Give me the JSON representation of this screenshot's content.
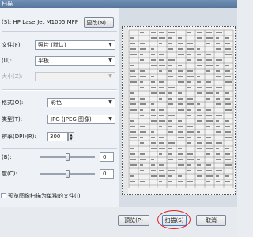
{
  "window": {
    "title": "扫描"
  },
  "scanner": {
    "label": "(S): HP LaserJet M1005 MFP",
    "change_button": "更改(N)..."
  },
  "settings": {
    "profile_label": "文件(F):",
    "profile_value": "照片 (默认)",
    "source_label": "(U):",
    "source_value": "平板",
    "paper_size_label": "大小(Z):",
    "paper_size_value": "",
    "color_format_label": "格式(O):",
    "color_format_value": "彩色",
    "file_type_label": "类型(T):",
    "file_type_value": "JPG (JPEG 图像)",
    "resolution_label": "辨率(DPI)(R):",
    "resolution_value": "300",
    "brightness_label": "(B):",
    "brightness_value": "0",
    "brightness_level": 0.5,
    "contrast_label": "度(C):",
    "contrast_value": "0",
    "contrast_level": 0.5,
    "separate_files_label": "预览图像扫描为单独的文件(I)"
  },
  "footer": {
    "preview_button": "预览(P)",
    "scan_button": "扫描(S)",
    "cancel_button": "取消"
  },
  "colors": {
    "highlight_circle": "#e02020",
    "title_bar": "#5f7fa6"
  },
  "icons": {
    "dropdown": "chevron-down-icon"
  }
}
